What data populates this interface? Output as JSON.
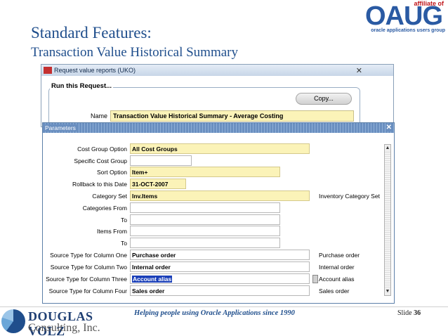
{
  "slide": {
    "title": "Standard Features:",
    "subtitle": "Transaction Value Historical Summary",
    "tagline": "Helping people using Oracle Applications since 1990",
    "slide_label": "Slide",
    "slide_number": "36"
  },
  "oaug_logo": {
    "affiliate": "affiliate of",
    "word": "OAUG",
    "tm": "™",
    "sub": "oracle applications users group"
  },
  "company_logo": {
    "name": "DOUGLAS VOLZ",
    "sub": "Consulting, Inc."
  },
  "request_window": {
    "title": "Request value reports (UKO)",
    "close_glyph": "✕",
    "group_label": "Run this Request...",
    "copy_button": "Copy...",
    "name_label": "Name",
    "name_value": "Transaction Value Historical Summary - Average Costing"
  },
  "parameters_window": {
    "title": "Parameters",
    "close_glyph": "✕",
    "rows": [
      {
        "label": "Cost Group Option",
        "value": "All Cost Groups",
        "desc": ""
      },
      {
        "label": "Specific Cost Group",
        "value": "",
        "desc": ""
      },
      {
        "label": "Sort Option",
        "value": "Item+",
        "desc": ""
      },
      {
        "label": "Rollback to this Date",
        "value": "31-OCT-2007",
        "desc": ""
      },
      {
        "label": "Category Set",
        "value": "Inv.Items",
        "desc": "Inventory Category Set"
      },
      {
        "label": "Categories From",
        "value": "",
        "desc": ""
      },
      {
        "label": "To",
        "value": "",
        "desc": ""
      },
      {
        "label": "Items From",
        "value": "",
        "desc": ""
      },
      {
        "label": "To",
        "value": "",
        "desc": ""
      },
      {
        "label": "Source Type for Column One",
        "value": "Purchase order",
        "desc": "Purchase order"
      },
      {
        "label": "Source Type for Column Two",
        "value": "Internal order",
        "desc": "Internal order"
      },
      {
        "label": "Source Type for Column Three",
        "value": "Account alias",
        "desc": "Account alias"
      },
      {
        "label": "Source Type for Column Four",
        "value": "Sales order",
        "desc": "Sales order"
      }
    ]
  },
  "colors": {
    "title_blue": "#1f4e8c",
    "required_field": "#fbf3b8",
    "selection": "#1a3fb8",
    "titlebar": "#6a8fc0"
  }
}
